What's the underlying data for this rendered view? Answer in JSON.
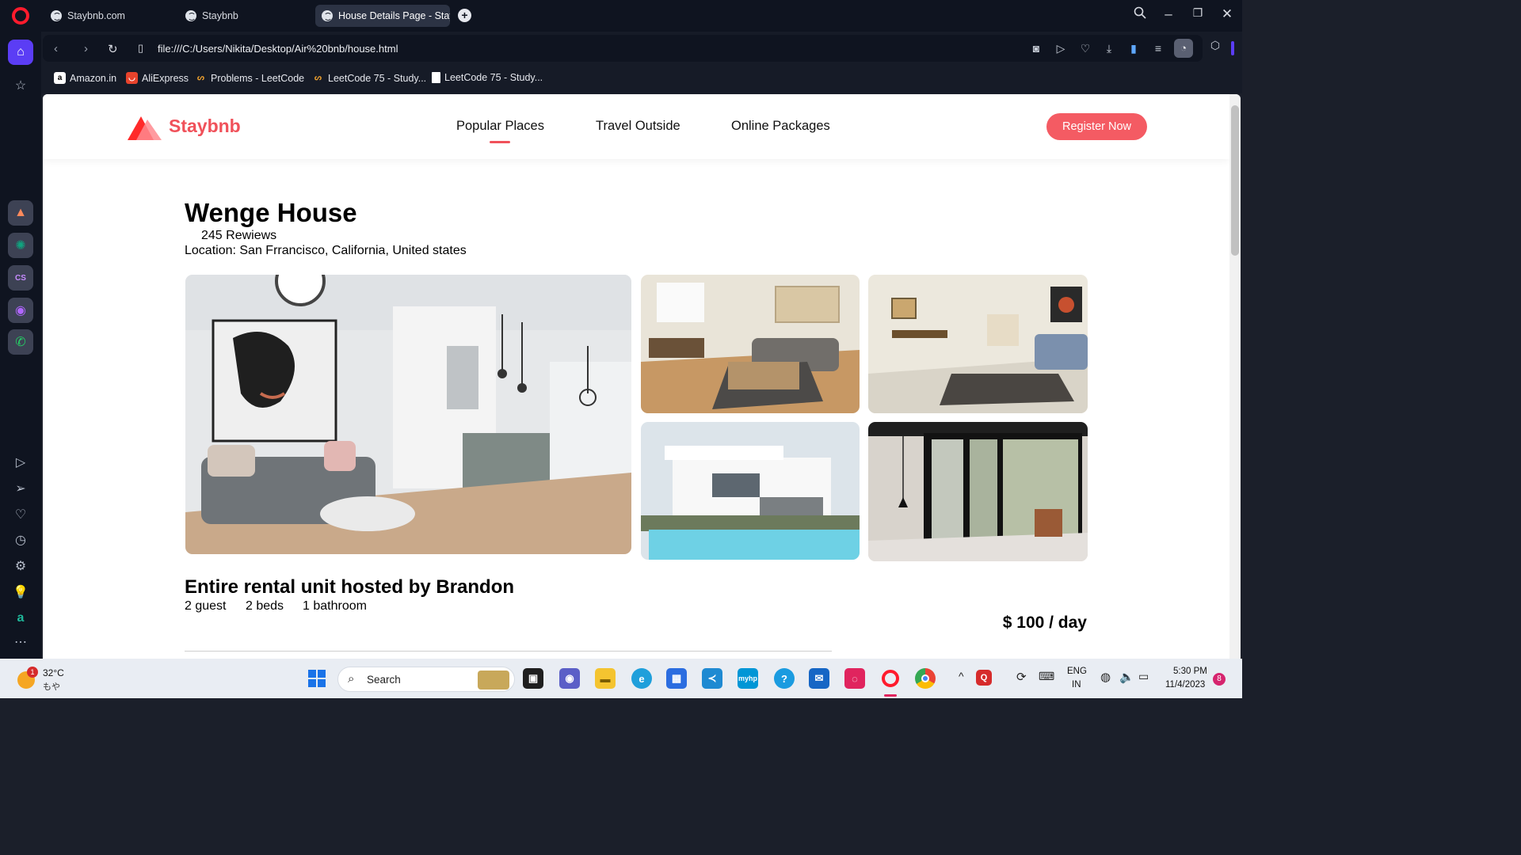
{
  "browser": {
    "tabs": [
      {
        "title": "Staybnb.com"
      },
      {
        "title": "Staybnb"
      },
      {
        "title": "House Details Page - Stay"
      }
    ],
    "url": "file:///C:/Users/Nikita/Desktop/Air%20bnb/house.html",
    "bookmarks": [
      {
        "label": "Amazon.in",
        "icon": "amazon-icon"
      },
      {
        "label": "AliExpress",
        "icon": "aliexpress-icon"
      },
      {
        "label": "Problems - LeetCode",
        "icon": "leetcode-icon"
      },
      {
        "label": "LeetCode 75 - Study...",
        "icon": "leetcode-icon"
      },
      {
        "label": "LeetCode 75 - Study...",
        "icon": "page-icon"
      }
    ]
  },
  "site": {
    "brand": "Staybnb",
    "brand_color": "#f0515a",
    "nav": [
      "Popular Places",
      "Travel Outside",
      "Online Packages"
    ],
    "active_nav": "Popular Places",
    "register_label": "Register Now"
  },
  "house": {
    "title": "Wenge House",
    "reviews": "245 Rewiews",
    "location": "Location: San Frrancisco, California, United states",
    "photos": [
      "living-room-kitchen-photo",
      "living-dining-photo",
      "lounge-photo",
      "modern-villa-pool-photo",
      "bedroom-glass-door-photo"
    ],
    "host": "Entire rental unit hosted by Brandon",
    "stats": [
      "2 guest",
      "2 beds",
      "1 bathroom"
    ],
    "price": "$ 100 / day"
  },
  "taskbar": {
    "weather_temp": "32°C",
    "weather_sub": "もや",
    "weather_badge": "1",
    "search_label": "Search",
    "lang_top": "ENG",
    "lang_bottom": "IN",
    "time": "5:30 PM",
    "date": "11/4/2023",
    "notif_count": "8"
  }
}
